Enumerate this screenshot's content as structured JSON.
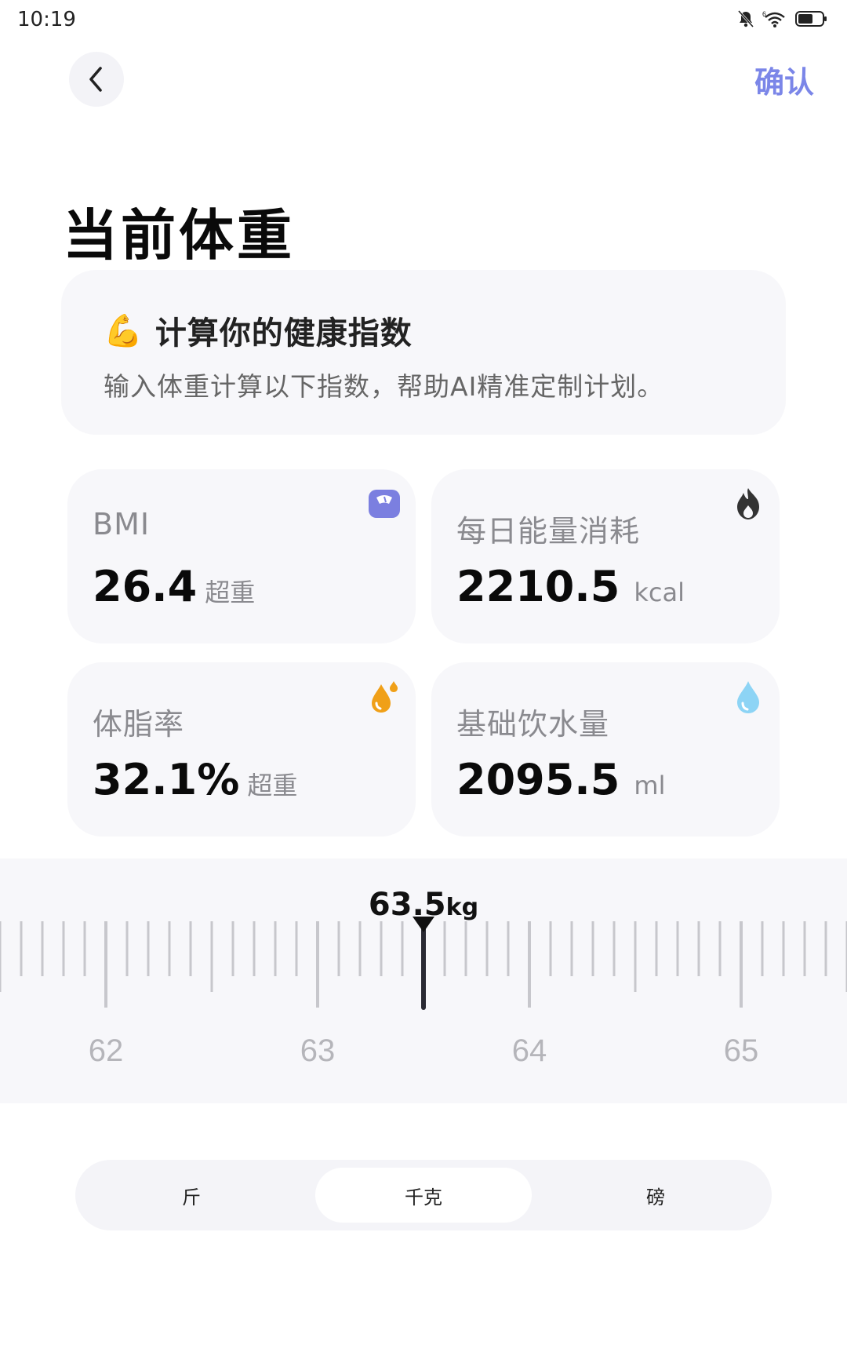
{
  "status": {
    "time": "10:19",
    "signal": "6"
  },
  "header": {
    "confirm_label": "确认"
  },
  "title": "当前体重",
  "intro": {
    "emoji": "💪",
    "title": "计算你的健康指数",
    "desc": "输入体重计算以下指数，帮助AI精准定制计划。"
  },
  "metrics": [
    {
      "label": "BMI",
      "value": "26.4",
      "unit": "超重",
      "icon": "scale-icon",
      "icon_color": "#7b7fe0"
    },
    {
      "label": "每日能量消耗",
      "value": "2210.5",
      "unit": "kcal",
      "icon": "flame-icon",
      "icon_color": "#333333"
    },
    {
      "label": "体脂率",
      "value": "32.1%",
      "unit": "超重",
      "icon": "oil-drop-icon",
      "icon_color": "#f0a018"
    },
    {
      "label": "基础饮水量",
      "value": "2095.5",
      "unit": "ml",
      "icon": "water-drop-icon",
      "icon_color": "#8dd4f5"
    }
  ],
  "ruler": {
    "value": "63.5",
    "unit": "kg",
    "current": 63.5,
    "min": 61.5,
    "max": 65.5,
    "labels": [
      "62",
      "63",
      "64",
      "65"
    ]
  },
  "unit_switch": {
    "options": [
      "斤",
      "千克",
      "磅"
    ],
    "selected": "千克"
  },
  "colors": {
    "accent": "#7b86e8",
    "card_bg": "#f7f7fa"
  }
}
